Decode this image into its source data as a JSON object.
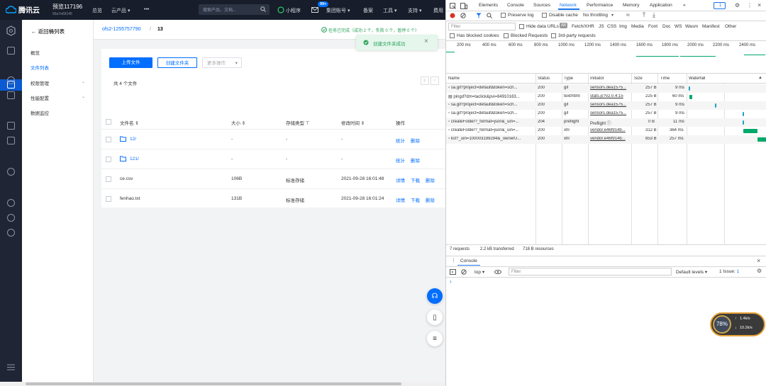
{
  "topbar": {
    "brand": "腾讯云",
    "account_name": "预览117196",
    "account_id": "56a7e69145",
    "nav": [
      "总览",
      "云产品 ▾",
      "•••"
    ],
    "search_placeholder": "搜索产品、文档...",
    "mini_program": "小程序",
    "mail_badge": "99+",
    "cost": "集团账号 ▾",
    "record": "备案",
    "tools": "工具 ▾",
    "support": "支持 ▾",
    "fee": "费用"
  },
  "sidebar": {
    "back": "返回桶列表",
    "items": [
      {
        "label": "概览"
      },
      {
        "label": "文件列表"
      },
      {
        "label": "权限管理"
      },
      {
        "label": "性能配置"
      },
      {
        "label": "数据监控"
      }
    ]
  },
  "breadcrumb": {
    "bucket": "ofs2-1255757790",
    "sep": "/",
    "folder": "13"
  },
  "task": {
    "text": "任务已完成（成功 2 个，失败 0 个，暂停 0 个）"
  },
  "toast": {
    "text": "创建文件夹成功"
  },
  "toolbar": {
    "upload": "上传文件",
    "create_folder": "创建文件夹",
    "more": "更多操作"
  },
  "file_count": "共 4 个文件",
  "pager": [
    "|‹",
    "‹"
  ],
  "table": {
    "headers": [
      "文件名 ⇕",
      "大小 ⇕",
      "存储类型 ⊤",
      "修改时间 ⇕",
      "操作"
    ],
    "rows": [
      {
        "name": "12/",
        "size": "-",
        "type": "-",
        "time": "-",
        "ops": [
          "统计",
          "删除"
        ],
        "folder": true
      },
      {
        "name": "121/",
        "size": "-",
        "type": "-",
        "time": "-",
        "ops": [
          "统计",
          "删除"
        ],
        "folder": true
      },
      {
        "name": "ce.csv",
        "size": "106B",
        "type": "标准存储",
        "time": "2021-09-28 16:01:48",
        "ops": [
          "详情",
          "下载",
          "删除"
        ],
        "folder": false
      },
      {
        "name": "fenhao.txt",
        "size": "131B",
        "type": "标准存储",
        "time": "2021-09-28 16:01:24",
        "ops": [
          "详情",
          "下载",
          "删除"
        ],
        "folder": false
      }
    ]
  },
  "devtools": {
    "tabs": [
      "Elements",
      "Console",
      "Sources",
      "Network",
      "Performance",
      "Memory",
      "Application",
      "»"
    ],
    "issue_count": "1",
    "controls": {
      "preserve": "Preserve log",
      "disable_cache": "Disable cache",
      "throttle": "No throttling"
    },
    "filter": {
      "placeholder": "Filter",
      "hide_data": "Hide data URLs",
      "types": [
        "All",
        "Fetch/XHR",
        "JS",
        "CSS",
        "Img",
        "Media",
        "Font",
        "Doc",
        "WS",
        "Wasm",
        "Manifest",
        "Other"
      ]
    },
    "checks": [
      "Has blocked cookies",
      "Blocked Requests",
      "3rd-party requests"
    ],
    "timeline": [
      "200 ms",
      "400 ms",
      "600 ms",
      "800 ms",
      "1000 ms",
      "1200 ms",
      "1400 ms",
      "1600 ms",
      "1800 ms",
      "2000 ms",
      "2200 ms",
      "2400 ms"
    ],
    "columns": [
      "Name",
      "Status",
      "Type",
      "Initiator",
      "Size",
      "Time",
      "Waterfall"
    ],
    "requests": [
      {
        "name": "sa.gif?project=default&token=sch...",
        "status": "200",
        "type": "gif",
        "initiator": "sensors.dea1575...",
        "size": "257 B",
        "time": "9 ms"
      },
      {
        "name": "pingd?dm=taclick&pvi=84910163...",
        "status": "200",
        "type": "text/html",
        "initiator": "stats.js?v2.0.4:15",
        "size": "225 B",
        "time": "60 ms"
      },
      {
        "name": "sa.gif?project=default&token=sch...",
        "status": "200",
        "type": "gif",
        "initiator": "sensors.dea1575...",
        "size": "257 B",
        "time": "9 ms"
      },
      {
        "name": "sa.gif?project=default&token=sch...",
        "status": "200",
        "type": "gif",
        "initiator": "sensors.dea1575...",
        "size": "257 B",
        "time": "9 ms"
      },
      {
        "name": "createFolder?_format=json&_uin=...",
        "status": "204",
        "type": "preflight",
        "initiator": "Preflight ⓘ",
        "size": "0 B",
        "time": "11 ms"
      },
      {
        "name": "createFolder?_format=json&_uin=...",
        "status": "200",
        "type": "xhr",
        "initiator": "vendor.e46f914b...",
        "size": "312 B",
        "time": "364 ms"
      },
      {
        "name": "list?_uin=100003199294&_ownerU...",
        "status": "200",
        "type": "xhr",
        "initiator": "vendor.e46f914b...",
        "size": "853 B",
        "time": "257 ms"
      }
    ],
    "summary": [
      "7 requests",
      "2.2 kB transferred",
      "718 B resources"
    ],
    "console": {
      "tab": "Console",
      "context": "top ▾",
      "filter": "Filter",
      "levels": "Default levels ▾",
      "issues": "1 Issue: ",
      "issue_n": "1",
      "prompt": "›"
    }
  },
  "gauge": {
    "percent": "78%",
    "up": "1.4k/s",
    "down": "10.2k/s"
  }
}
